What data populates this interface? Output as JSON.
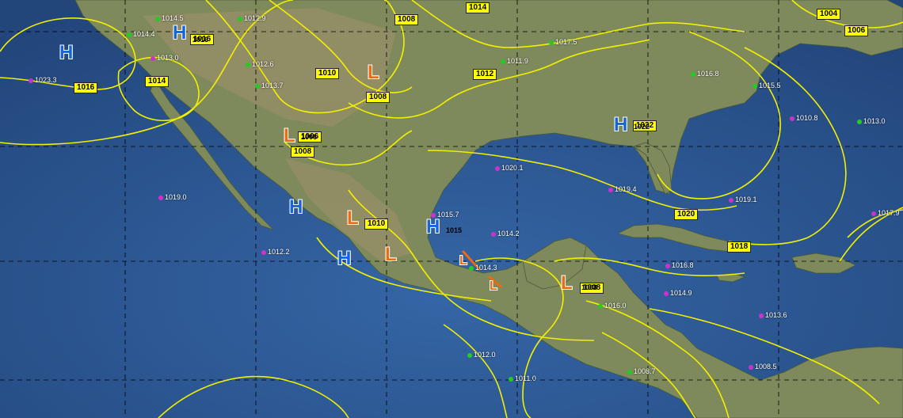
{
  "colors": {
    "ocean": "#2f5b95",
    "ocean_dark": "#24487a",
    "land": "#7a8a5a",
    "land_dry": "#9c9070",
    "isobar": "#f2f000",
    "grid": "#000000",
    "high": "#1565d8",
    "low": "#ee6a10",
    "station_green": "#22cc22",
    "station_purple": "#cc33cc"
  },
  "isobar_labels": [
    "1008",
    "1014",
    "1004",
    "1006",
    "1016",
    "1016",
    "1014",
    "1010",
    "1008",
    "1012",
    "1006",
    "1008",
    "1010",
    "1022",
    "1020",
    "1018",
    "1008"
  ],
  "pressure_centers": [
    {
      "type": "H",
      "label": "1016"
    },
    {
      "type": "H",
      "label": ""
    },
    {
      "type": "L",
      "label": ""
    },
    {
      "type": "L",
      "label": "1006"
    },
    {
      "type": "H",
      "label": "1022"
    },
    {
      "type": "H",
      "label": ""
    },
    {
      "type": "L",
      "label": ""
    },
    {
      "type": "H",
      "label": "1015"
    },
    {
      "type": "H",
      "label": ""
    },
    {
      "type": "L",
      "label": ""
    },
    {
      "type": "L",
      "label": ""
    },
    {
      "type": "L",
      "label": ""
    },
    {
      "type": "L",
      "label": "1008"
    }
  ],
  "station_observations": [
    {
      "text": "1014.5",
      "color": "green"
    },
    {
      "text": "1012.9",
      "color": "green"
    },
    {
      "text": "1013.0",
      "color": "purple"
    },
    {
      "text": "1023.3",
      "color": "purple"
    },
    {
      "text": "1014.4",
      "color": "green"
    },
    {
      "text": "1012.6",
      "color": "green"
    },
    {
      "text": "1013.7",
      "color": "green"
    },
    {
      "text": "1011.9",
      "color": "green"
    },
    {
      "text": "1017.5",
      "color": "green"
    },
    {
      "text": "1016.8",
      "color": "green"
    },
    {
      "text": "1015.5",
      "color": "green"
    },
    {
      "text": "1013.0",
      "color": "green"
    },
    {
      "text": "1010.8",
      "color": "purple"
    },
    {
      "text": "1019.0",
      "color": "purple"
    },
    {
      "text": "1020.1",
      "color": "purple"
    },
    {
      "text": "1019.4",
      "color": "purple"
    },
    {
      "text": "1019.1",
      "color": "purple"
    },
    {
      "text": "1017.9",
      "color": "purple"
    },
    {
      "text": "1012.2",
      "color": "purple"
    },
    {
      "text": "1014.2",
      "color": "purple"
    },
    {
      "text": "1016.8",
      "color": "purple"
    },
    {
      "text": "1014.9",
      "color": "purple"
    },
    {
      "text": "1013.6",
      "color": "purple"
    },
    {
      "text": "1012.0",
      "color": "green"
    },
    {
      "text": "1011.0",
      "color": "green"
    },
    {
      "text": "1008.7",
      "color": "green"
    },
    {
      "text": "1008.5",
      "color": "purple"
    },
    {
      "text": "1014.3",
      "color": "green"
    },
    {
      "text": "1016.0",
      "color": "green"
    },
    {
      "text": "1015.7",
      "color": "purple"
    }
  ]
}
